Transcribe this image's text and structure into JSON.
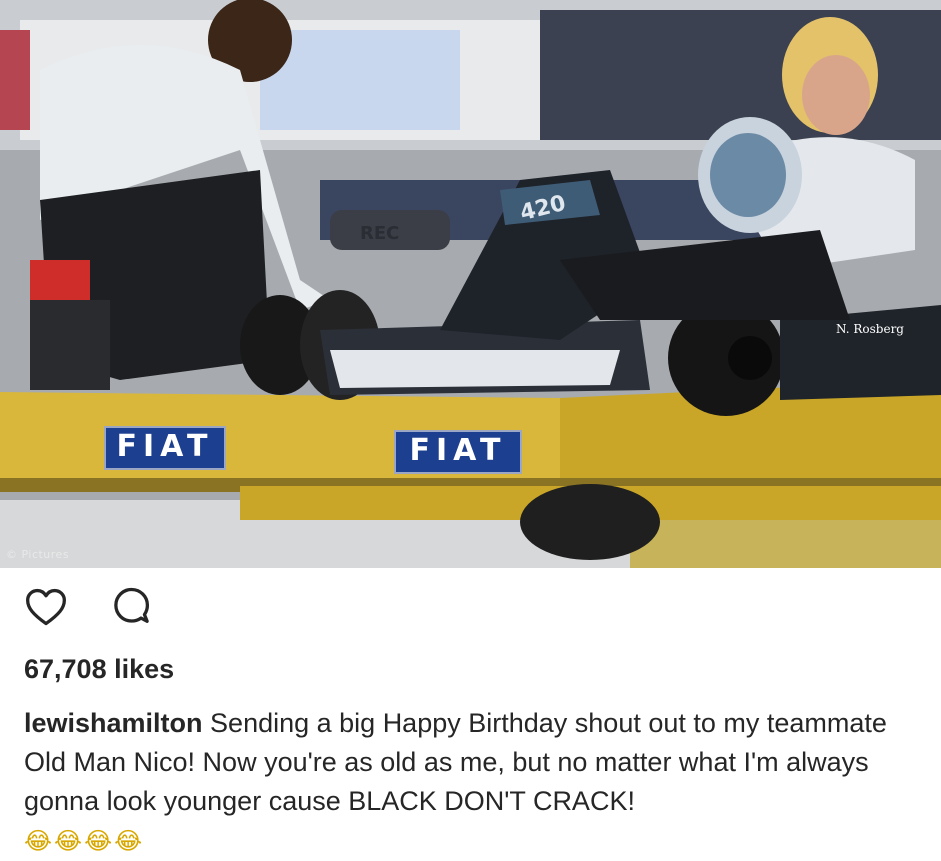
{
  "photo": {
    "alt": "",
    "credit": "© Pictures",
    "banner_text": "",
    "fiat_badges": [
      "FIAT",
      "FIAT"
    ],
    "rec_text": "REC",
    "kart_number": "420",
    "name_plate": "N. Rosberg"
  },
  "actions": {
    "like_icon": "heart-outline-icon",
    "comment_icon": "comment-bubble-icon"
  },
  "likes": {
    "text": "67,708 likes"
  },
  "caption": {
    "username": "lewishamilton",
    "text": " Sending a big Happy Birthday shout out to my teammate Old Man Nico! Now you're as old as me, but no matter what I'm always gonna look younger cause BLACK DON'T CRACK!",
    "emojis": "😂😂😂😂"
  },
  "colors": {
    "text": "#262626",
    "trailer_yellow": "#d9b73a",
    "fiat_blue": "#1d3f8f"
  }
}
